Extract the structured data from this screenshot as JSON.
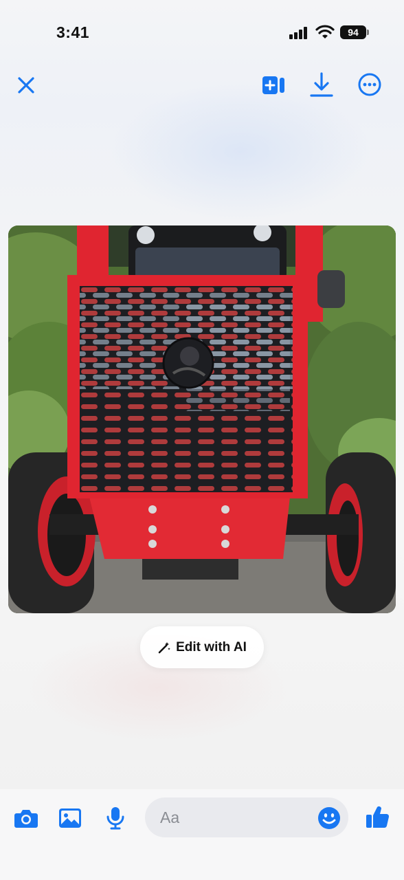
{
  "status_bar": {
    "time": "3:41",
    "battery_level": "94",
    "signal_icon": "cellular-signal-icon",
    "wifi_icon": "wifi-icon",
    "battery_icon": "battery-icon"
  },
  "header": {
    "close_icon": "close-icon",
    "add_to_story_icon": "add-to-story-icon",
    "download_icon": "download-icon",
    "more_icon": "more-options-icon",
    "accent_color": "#1877F2"
  },
  "photo": {
    "subject": "red tractor front with black perforated metal grille guard",
    "logo_icon": "grille-logo-icon"
  },
  "edit_ai": {
    "label": "Edit with AI",
    "icon": "magic-wand-icon"
  },
  "composer": {
    "placeholder": "Aa",
    "camera_icon": "camera-icon",
    "gallery_icon": "gallery-icon",
    "mic_icon": "microphone-icon",
    "emoji_icon": "emoji-icon",
    "like_icon": "thumbs-up-icon"
  }
}
